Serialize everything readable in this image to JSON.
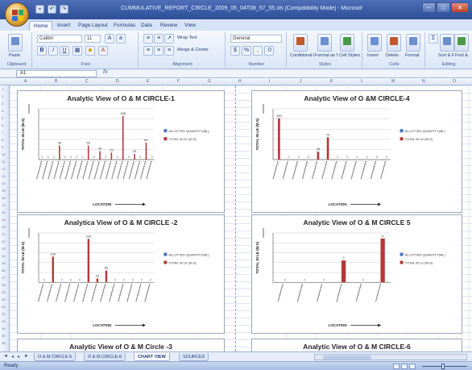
{
  "window": {
    "title": "CUMMULATIVE_REPORT_CIRCLE_2009_05_04T08_57_55.xls [Compatibility Mode] - Microsoft Excel"
  },
  "ribbon_tabs": [
    "Home",
    "Insert",
    "Page Layout",
    "Formulas",
    "Data",
    "Review",
    "View"
  ],
  "ribbon": {
    "paste": "Paste",
    "font_name": "Calibri",
    "font_size": "11",
    "wrap_text": "Wrap Text",
    "merge_center": "Merge & Center",
    "number_format": "General",
    "conditional_formatting": "Conditional Formatting",
    "format_as_table": "Format as Table",
    "cell_styles": "Cell Styles",
    "insert": "Insert",
    "delete": "Delete",
    "format": "Format",
    "sort_filter": "Sort & Filter",
    "find_select": "Find & Select",
    "groups": [
      "Clipboard",
      "Font",
      "Alignment",
      "Number",
      "Styles",
      "Cells",
      "Editing"
    ]
  },
  "formula_bar": {
    "name_box": "A1",
    "fx": "fx"
  },
  "column_headers": [
    "A",
    "B",
    "C",
    "D",
    "E",
    "F",
    "G",
    "H",
    "I",
    "J",
    "K",
    "L",
    "M",
    "N",
    "O"
  ],
  "sheet_tabs": [
    "O & M CIRCLE-5",
    "O & M CIRCLE-6",
    "CHART VIEW",
    "SOURCES"
  ],
  "active_sheet": "CHART VIEW",
  "status": {
    "ready": "Ready"
  },
  "colors": {
    "allotted": "#4a6fc0",
    "total": "#b03a3a"
  },
  "chart_data": [
    {
      "type": "bar",
      "title": "Analytic View of O & M CIRCLE-1",
      "ylabel": "TOTAL IN LE (M.S)",
      "xlabel": "LOCATION",
      "categories": [
        "",
        "",
        "",
        "",
        "",
        "",
        "",
        "",
        "",
        "",
        "",
        "",
        "",
        "",
        "",
        "",
        "",
        "",
        "",
        ""
      ],
      "series": [
        {
          "name": "ALLOTTED QUANTITY(ML)",
          "values": [
            0,
            0,
            0,
            0,
            0,
            0,
            0,
            0,
            0,
            0,
            0,
            0,
            0,
            0,
            0,
            0,
            0,
            0,
            0,
            0
          ]
        },
        {
          "name": "TOTAL IN LE (M.S)",
          "values": [
            0,
            0,
            0,
            50,
            0,
            0,
            0,
            0,
            50,
            0,
            30,
            0,
            25,
            0,
            155,
            0,
            20,
            0,
            60,
            0
          ]
        }
      ],
      "ylim": [
        0,
        180
      ],
      "legend": "right"
    },
    {
      "type": "bar",
      "title": "Analytic View of O &M CIRCLE-4",
      "ylabel": "TOTAL IN LE (M.S)",
      "xlabel": "LOCATION",
      "categories": [
        "",
        "",
        "",
        "",
        "",
        "",
        "",
        "",
        "",
        "",
        "",
        ""
      ],
      "series": [
        {
          "name": "ALLOTTED QUANTITY(ML)",
          "values": [
            0,
            0,
            0,
            0,
            0,
            0,
            0,
            0,
            0,
            0,
            0,
            0
          ]
        },
        {
          "name": "TOTAL IN LE (M.S)",
          "values": [
            130,
            0,
            0,
            0,
            25,
            70,
            0,
            0,
            0,
            0,
            0,
            0
          ]
        }
      ],
      "ylim": [
        0,
        160
      ],
      "legend": "right"
    },
    {
      "type": "bar",
      "title": "Analytica View of  O & M CIRCLE -2",
      "ylabel": "TOTAL IN LE (M.S)",
      "xlabel": "LOCATION",
      "categories": [
        "",
        "",
        "",
        "",
        "",
        "",
        "",
        "",
        "",
        "",
        "",
        "",
        ""
      ],
      "series": [
        {
          "name": "ALLOTTED QUANTITY(ML)",
          "values": [
            0,
            0,
            0,
            0,
            0,
            0,
            0,
            0,
            0,
            0,
            0,
            0,
            0
          ]
        },
        {
          "name": "TOTAL IN LE (M.S)",
          "values": [
            0,
            130,
            0,
            0,
            0,
            220,
            20,
            60,
            0,
            0,
            0,
            0,
            0
          ]
        }
      ],
      "ylim": [
        0,
        250
      ],
      "legend": "right"
    },
    {
      "type": "bar",
      "title": "Analytic View of O & M CIRCLE 5",
      "ylabel": "TOTAL IN LE (M.S)",
      "xlabel": "LOCATION",
      "categories": [
        "",
        "",
        "",
        "",
        "",
        ""
      ],
      "series": [
        {
          "name": "ALLOTTED QUANTITY(ML)",
          "values": [
            0,
            0,
            0,
            0,
            0,
            0
          ]
        },
        {
          "name": "TOTAL IN LE (M.S)",
          "values": [
            0,
            0,
            0,
            2,
            0,
            4
          ]
        }
      ],
      "ylim": [
        0,
        4.5
      ],
      "legend": "right"
    },
    {
      "type": "bar",
      "title": "Analytic View of O & M Circle -3",
      "categories": [],
      "series": []
    },
    {
      "type": "bar",
      "title": "Analytic View of O & M CIRCLE-6",
      "categories": [],
      "series": []
    }
  ]
}
